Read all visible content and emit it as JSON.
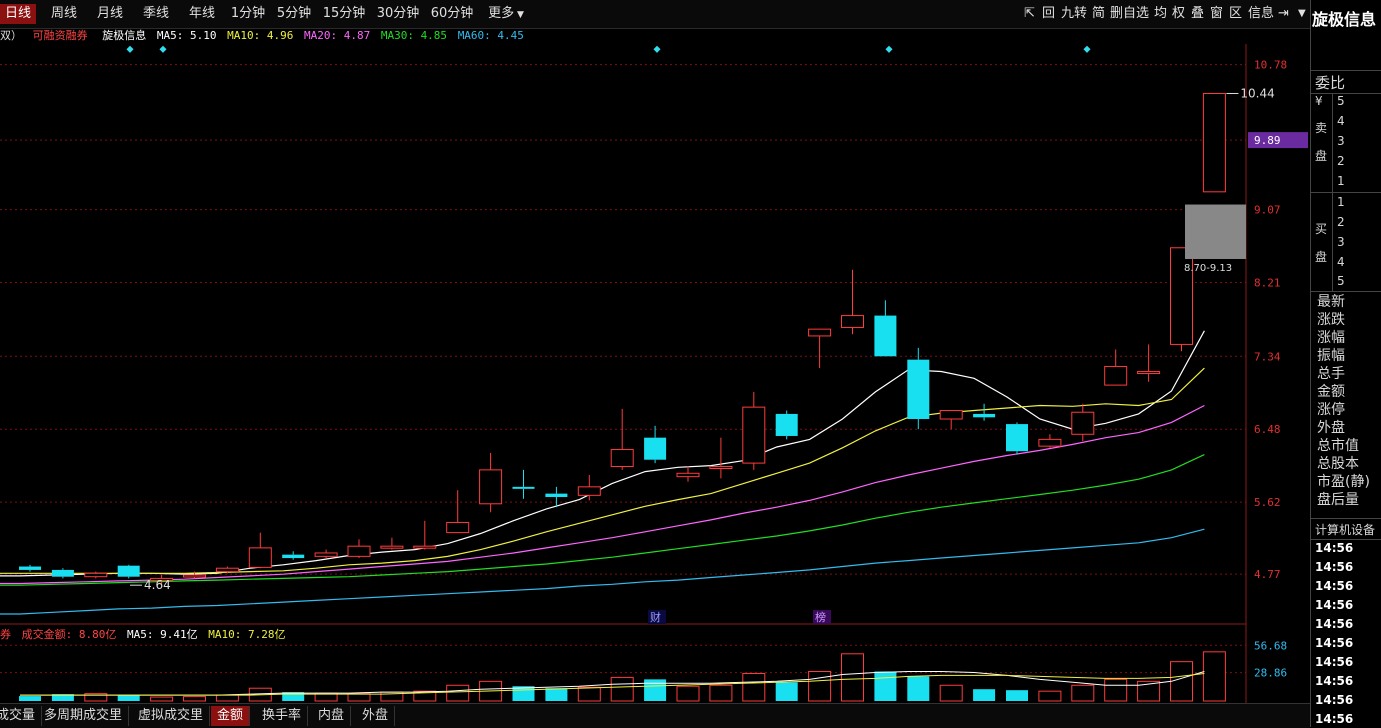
{
  "top_tabs": [
    "日线",
    "周线",
    "月线",
    "季线",
    "年线",
    "1分钟",
    "5分钟",
    "15分钟",
    "30分钟",
    "60分钟",
    "更多"
  ],
  "toolbar_right": [
    "回",
    "九转",
    "简",
    "删自选",
    "均",
    "权",
    "叠",
    "窗",
    "区",
    "信息"
  ],
  "app_title": "旋极信息",
  "info": {
    "prefix": "双）",
    "margin_label": "可融资融券",
    "stock_name": "旋极信息",
    "ma5": "MA5: 5.10",
    "ma10": "MA10: 4.96",
    "ma20": "MA20: 4.87",
    "ma30": "MA30: 4.85",
    "ma60": "MA60: 4.45"
  },
  "sub_info": {
    "prefix": "券",
    "amount": "成交金额: 8.80亿",
    "ma5": "MA5: 9.41亿",
    "ma10": "MA10: 7.28亿"
  },
  "price_axis": [
    "10.78",
    "9.89",
    "9.07",
    "8.21",
    "7.34",
    "6.48",
    "5.62",
    "4.77"
  ],
  "highlight_price": "9.89",
  "volume_axis": [
    "56.68",
    "28.86"
  ],
  "annotations": {
    "high": "10.44",
    "low": "4.64",
    "range": "8.70-9.13",
    "cai": "财",
    "bang": "榜"
  },
  "bottom_tabs": [
    "成交量",
    "多周期成交里",
    "虚拟成交里",
    "金额",
    "换手率",
    "内盘",
    "外盘"
  ],
  "right_panel": {
    "weibi": "委比",
    "sell_label": [
      "¥",
      "卖",
      "盘"
    ],
    "sell_levels": [
      "5",
      "4",
      "3",
      "2",
      "1"
    ],
    "buy_label": [
      "买",
      "盘"
    ],
    "buy_levels": [
      "1",
      "2",
      "3",
      "4",
      "5"
    ],
    "fields": [
      "最新",
      "涨跌",
      "涨幅",
      "振幅",
      "总手",
      "金额",
      "涨停",
      "外盘",
      "总市值",
      "总股本",
      "市盈(静)",
      "盘后量"
    ],
    "industry": "计算机设备",
    "times": [
      "14:56",
      "14:56",
      "14:56",
      "14:56",
      "14:56",
      "14:56",
      "14:56",
      "14:56",
      "14:56",
      "14:56"
    ]
  },
  "colors": {
    "up": "#ff3b3b",
    "down": "#18e0f0",
    "ma5": "#ffffff",
    "ma10": "#f0f040",
    "ma20": "#ff66ff",
    "ma30": "#22dd22",
    "ma60": "#33bbee",
    "grid": "#7a1010",
    "accent": "#8b1010"
  },
  "chart_data": {
    "type": "candlestick",
    "ylim": [
      4.3,
      11.0
    ],
    "candles": [
      {
        "o": 4.86,
        "c": 4.82,
        "h": 4.88,
        "l": 4.8
      },
      {
        "o": 4.82,
        "c": 4.74,
        "h": 4.84,
        "l": 4.72
      },
      {
        "o": 4.74,
        "c": 4.78,
        "h": 4.8,
        "l": 4.72
      },
      {
        "o": 4.87,
        "c": 4.74,
        "h": 4.88,
        "l": 4.72
      },
      {
        "o": 4.7,
        "c": 4.72,
        "h": 4.76,
        "l": 4.64
      },
      {
        "o": 4.74,
        "c": 4.76,
        "h": 4.8,
        "l": 4.72
      },
      {
        "o": 4.8,
        "c": 4.84,
        "h": 4.86,
        "l": 4.78
      },
      {
        "o": 4.85,
        "c": 5.08,
        "h": 5.26,
        "l": 4.84
      },
      {
        "o": 5.0,
        "c": 4.96,
        "h": 5.04,
        "l": 4.94
      },
      {
        "o": 4.98,
        "c": 5.02,
        "h": 5.06,
        "l": 4.96
      },
      {
        "o": 4.98,
        "c": 5.1,
        "h": 5.18,
        "l": 4.96
      },
      {
        "o": 5.08,
        "c": 5.1,
        "h": 5.2,
        "l": 5.06
      },
      {
        "o": 5.1,
        "c": 5.1,
        "h": 5.4,
        "l": 5.06
      },
      {
        "o": 5.26,
        "c": 5.38,
        "h": 5.76,
        "l": 5.26
      },
      {
        "o": 5.6,
        "c": 6.0,
        "h": 6.2,
        "l": 5.5
      },
      {
        "o": 5.8,
        "c": 5.78,
        "h": 6.0,
        "l": 5.66
      },
      {
        "o": 5.72,
        "c": 5.68,
        "h": 5.8,
        "l": 5.56
      },
      {
        "o": 5.7,
        "c": 5.8,
        "h": 5.94,
        "l": 5.64
      },
      {
        "o": 6.04,
        "c": 6.24,
        "h": 6.72,
        "l": 6.0
      },
      {
        "o": 6.38,
        "c": 6.12,
        "h": 6.52,
        "l": 6.08
      },
      {
        "o": 5.92,
        "c": 5.96,
        "h": 6.04,
        "l": 5.86
      },
      {
        "o": 6.02,
        "c": 6.04,
        "h": 6.38,
        "l": 5.9
      },
      {
        "o": 6.08,
        "c": 6.74,
        "h": 6.92,
        "l": 6.0
      },
      {
        "o": 6.66,
        "c": 6.4,
        "h": 6.7,
        "l": 6.36
      },
      {
        "o": 7.58,
        "c": 7.66,
        "h": 7.66,
        "l": 7.2
      },
      {
        "o": 7.68,
        "c": 7.82,
        "h": 8.36,
        "l": 7.6
      },
      {
        "o": 7.82,
        "c": 7.34,
        "h": 8.0,
        "l": 7.34
      },
      {
        "o": 7.3,
        "c": 6.6,
        "h": 7.44,
        "l": 6.48
      },
      {
        "o": 6.6,
        "c": 6.7,
        "h": 6.7,
        "l": 6.48
      },
      {
        "o": 6.66,
        "c": 6.62,
        "h": 6.78,
        "l": 6.58
      },
      {
        "o": 6.54,
        "c": 6.22,
        "h": 6.56,
        "l": 6.18
      },
      {
        "o": 6.28,
        "c": 6.36,
        "h": 6.42,
        "l": 6.26
      },
      {
        "o": 6.42,
        "c": 6.68,
        "h": 6.78,
        "l": 6.34
      },
      {
        "o": 7.0,
        "c": 7.22,
        "h": 7.42,
        "l": 7.0
      },
      {
        "o": 7.16,
        "c": 7.16,
        "h": 7.48,
        "l": 7.04
      },
      {
        "o": 7.48,
        "c": 8.62,
        "h": 8.62,
        "l": 7.4
      },
      {
        "o": 9.28,
        "c": 10.44,
        "h": 10.44,
        "l": 9.28
      }
    ],
    "ma_series": [
      {
        "name": "MA5",
        "values": [
          4.75,
          4.76,
          4.77,
          4.78,
          4.78,
          4.77,
          4.78,
          4.84,
          4.88,
          4.93,
          4.99,
          5.03,
          5.06,
          5.13,
          5.25,
          5.4,
          5.54,
          5.65,
          5.84,
          5.98,
          6.03,
          6.05,
          6.11,
          6.27,
          6.36,
          6.6,
          6.92,
          7.18,
          7.16,
          7.08,
          6.86,
          6.6,
          6.48,
          6.55,
          6.66,
          6.93,
          7.64
        ]
      },
      {
        "name": "MA10",
        "values": [
          4.78,
          4.78,
          4.78,
          4.78,
          4.78,
          4.78,
          4.79,
          4.8,
          4.81,
          4.84,
          4.88,
          4.9,
          4.93,
          4.98,
          5.06,
          5.16,
          5.27,
          5.37,
          5.47,
          5.57,
          5.65,
          5.72,
          5.84,
          5.96,
          6.08,
          6.26,
          6.46,
          6.62,
          6.67,
          6.7,
          6.73,
          6.76,
          6.75,
          6.78,
          6.76,
          6.83,
          7.2
        ]
      },
      {
        "name": "MA20",
        "values": [
          4.66,
          4.67,
          4.68,
          4.69,
          4.7,
          4.71,
          4.73,
          4.75,
          4.77,
          4.8,
          4.83,
          4.86,
          4.89,
          4.92,
          4.97,
          5.02,
          5.08,
          5.14,
          5.2,
          5.27,
          5.34,
          5.41,
          5.49,
          5.56,
          5.64,
          5.74,
          5.85,
          5.94,
          6.02,
          6.1,
          6.17,
          6.23,
          6.3,
          6.38,
          6.44,
          6.56,
          6.76
        ]
      },
      {
        "name": "MA30",
        "values": [
          4.64,
          4.65,
          4.66,
          4.67,
          4.68,
          4.69,
          4.7,
          4.71,
          4.72,
          4.73,
          4.74,
          4.76,
          4.78,
          4.8,
          4.83,
          4.86,
          4.89,
          4.93,
          4.97,
          5.02,
          5.07,
          5.12,
          5.17,
          5.22,
          5.28,
          5.35,
          5.43,
          5.5,
          5.56,
          5.61,
          5.66,
          5.71,
          5.76,
          5.82,
          5.89,
          6.0,
          6.18
        ]
      },
      {
        "name": "MA60",
        "values": [
          4.3,
          4.32,
          4.34,
          4.36,
          4.37,
          4.39,
          4.4,
          4.42,
          4.44,
          4.46,
          4.48,
          4.5,
          4.52,
          4.54,
          4.56,
          4.58,
          4.6,
          4.63,
          4.65,
          4.68,
          4.7,
          4.73,
          4.76,
          4.79,
          4.82,
          4.86,
          4.9,
          4.93,
          4.96,
          4.99,
          5.02,
          5.05,
          5.08,
          5.11,
          5.14,
          5.2,
          5.3
        ]
      }
    ],
    "volume": [
      5.0,
      7.0,
      7.5,
      6.0,
      4.0,
      4.5,
      6.0,
      13.0,
      9.0,
      8.0,
      7.5,
      9.0,
      10.0,
      16.0,
      20.0,
      15.0,
      13.0,
      14.0,
      24.0,
      22.0,
      15.0,
      16.0,
      28.0,
      19.0,
      30.0,
      48.0,
      30.0,
      25.0,
      16.0,
      12.0,
      11.0,
      10.0,
      16.0,
      22.0,
      20.0,
      40.0,
      50.0
    ],
    "volume_ylim": [
      0,
      60
    ],
    "volume_ma": [
      {
        "name": "MA5",
        "values": [
          6,
          6,
          6,
          6,
          6,
          6,
          6,
          7,
          8,
          8,
          8,
          9,
          9,
          10,
          12,
          13,
          14,
          15,
          17,
          18,
          18,
          18,
          19,
          20,
          22,
          27,
          29,
          30,
          30,
          29,
          26,
          22,
          19,
          16,
          16,
          20,
          30
        ]
      },
      {
        "name": "MA10",
        "values": [
          6,
          6,
          6,
          6,
          6,
          6,
          6,
          6,
          7,
          7,
          7,
          7,
          8,
          9,
          10,
          11,
          12,
          13,
          14,
          15,
          16,
          17,
          18,
          19,
          20,
          22,
          23,
          25,
          26,
          26,
          26,
          25,
          24,
          23,
          23,
          24,
          28
        ]
      }
    ]
  }
}
